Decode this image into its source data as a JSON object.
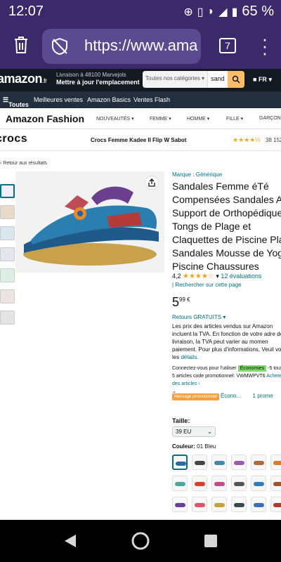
{
  "status_bar": {
    "time": "12:07",
    "battery": "65 %"
  },
  "browser": {
    "url": "https://www.ama",
    "tab_count": "7"
  },
  "amazon_header": {
    "logo": "amazon",
    "logo_suffix": ".fr",
    "deliver_line1": "Livraison à 48100 Marvejols",
    "deliver_line2": "Mettre à jour l'emplacement",
    "search_category": "Toutes nos catégories",
    "search_value": "sand",
    "lang": "FR"
  },
  "nav": {
    "items": [
      "Toutes",
      "Meilleures ventes",
      "Amazon Basics",
      "Ventes Flash"
    ]
  },
  "fashion_bar": {
    "title": "Amazon Fashion",
    "categories": [
      "NOUVEAUTÉS",
      "FEMME",
      "HOMME",
      "FILLE",
      "GARÇON"
    ]
  },
  "brand_bar": {
    "brand": "crocs",
    "product": "Crocs Femme Kadee II Flip W Sabot",
    "rating_count": "38 152"
  },
  "back_link": "‹ Retour aux résultats",
  "product": {
    "brand_link": "Marque : Générique",
    "title": "Sandales Femme éTé Compensées Sandales A Support de Orthopédique Tongs de Plage et Claquettes de Piscine Pla Sandales Mousse de Yog Piscine Chaussures",
    "rating": "4,2",
    "ratings_count": "12 évaluations",
    "search_link": "Rechercher sur cette page",
    "price_whole": "5",
    "price_fraction": "99 €",
    "returns": "Retours GRATUITS",
    "vat_note": "Les prix des articles vendus sur Amazon incluent la TVA. En fonction de votre adre de livraison, la TVA peut varier au momen paiement. Pour plus d'informations, Veuil voir les",
    "vat_link": "détails.",
    "promo_prefix": "Connectez-vous pour l'utiliser",
    "promo_badge": "Économies",
    "promo_pct": "-5",
    "promo_text": "tous les 5 articles code promotionnel: VWMWPVT6",
    "promo_link": "Acheter des articles ›",
    "promo_label": "Message promotionnel",
    "promo_econo": "Écono...",
    "promo_more": "1 prome",
    "size_label": "Taille:",
    "size_value": "39 EU",
    "color_label": "Couleur:",
    "color_value": "01 Bleu",
    "swatch_colors": [
      "#2d6aa3",
      "#444",
      "#3e8aa8",
      "#9b5bb0",
      "#b06a3b",
      "#e07a2e",
      "#4aa8a0",
      "#d8432a",
      "#c64a8e",
      "#555",
      "#2f7fc0",
      "#a0522d",
      "#6a3e9e",
      "#e0556a",
      "#c2a23a",
      "#37474f",
      "#3a6fc0",
      "#b03a2e"
    ]
  }
}
